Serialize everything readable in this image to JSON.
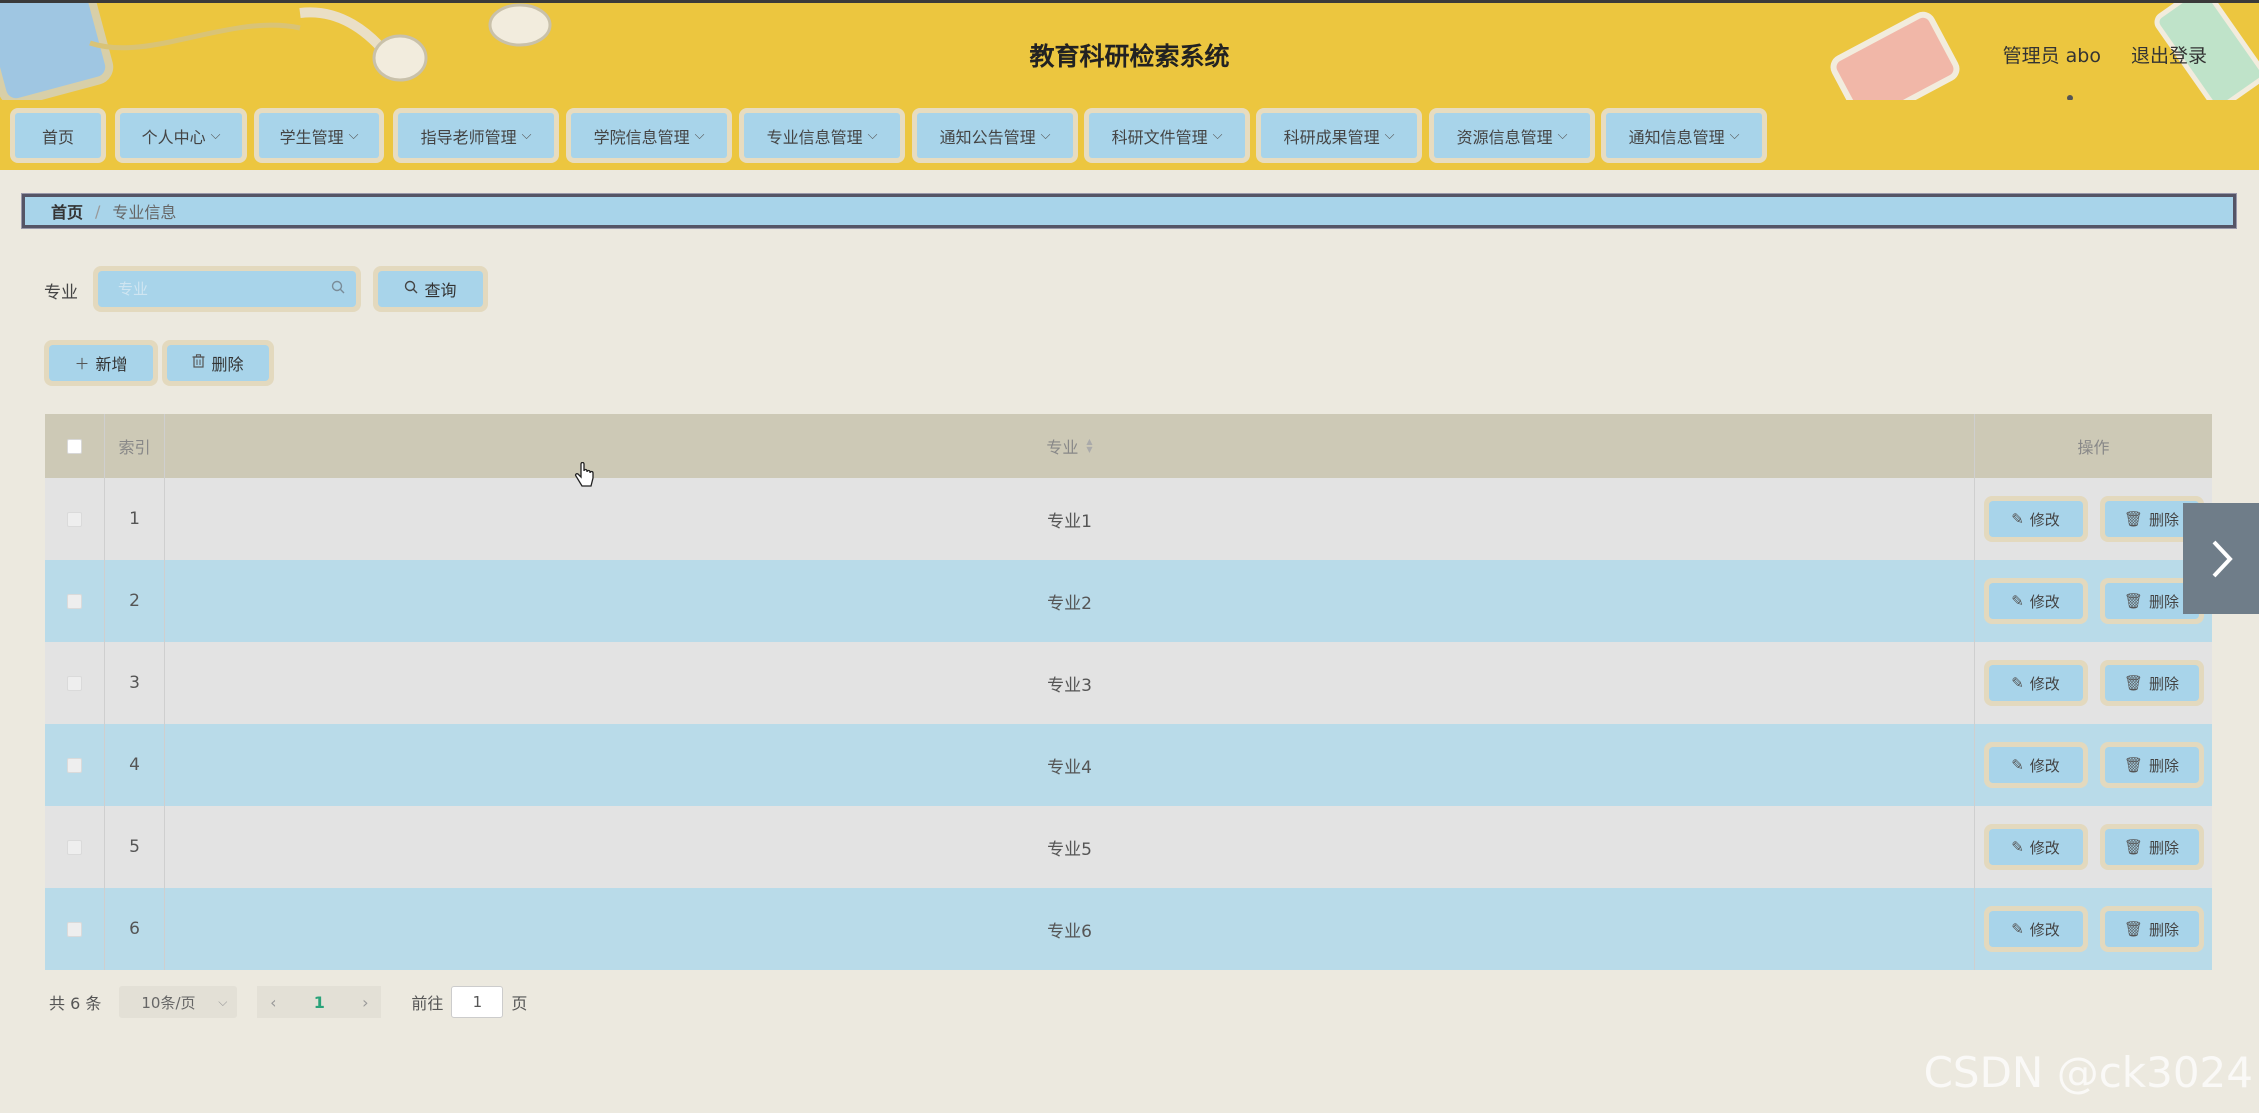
{
  "header": {
    "title": "教育科研检索系统",
    "user_label": "管理员 abo",
    "logout_label": "退出登录"
  },
  "nav": [
    {
      "label": "首页"
    },
    {
      "label": "个人中心"
    },
    {
      "label": "学生管理"
    },
    {
      "label": "指导老师管理"
    },
    {
      "label": "学院信息管理"
    },
    {
      "label": "专业信息管理"
    },
    {
      "label": "通知公告管理"
    },
    {
      "label": "科研文件管理"
    },
    {
      "label": "科研成果管理"
    },
    {
      "label": "资源信息管理"
    },
    {
      "label": "通知信息管理"
    }
  ],
  "breadcrumb": {
    "home": "首页",
    "separator": "/",
    "current": "专业信息"
  },
  "search": {
    "label": "专业",
    "placeholder": "专业",
    "button_label": "查询"
  },
  "actions": {
    "add_label": "新增",
    "delete_label": "删除"
  },
  "table": {
    "headers": {
      "index": "索引",
      "major": "专业",
      "ops": "操作"
    },
    "rows": [
      {
        "index": "1",
        "major": "专业1",
        "edit": "修改",
        "delete": "删除"
      },
      {
        "index": "2",
        "major": "专业2",
        "edit": "修改",
        "delete": "删除"
      },
      {
        "index": "3",
        "major": "专业3",
        "edit": "修改",
        "delete": "删除"
      },
      {
        "index": "4",
        "major": "专业4",
        "edit": "修改",
        "delete": "删除"
      },
      {
        "index": "5",
        "major": "专业5",
        "edit": "修改",
        "delete": "删除"
      },
      {
        "index": "6",
        "major": "专业6",
        "edit": "修改",
        "delete": "删除"
      }
    ]
  },
  "pagination": {
    "total": "共 6 条",
    "page_size": "10条/页",
    "current_page": "1",
    "goto_label": "前往",
    "goto_value": "1",
    "page_suffix": "页"
  },
  "watermark": "CSDN @ck3024",
  "colors": {
    "header_bg": "#ecc63f",
    "button_bg": "#a8d4ea",
    "row_alt": "#b9dbe9",
    "table_header": "#cdc9b6"
  }
}
